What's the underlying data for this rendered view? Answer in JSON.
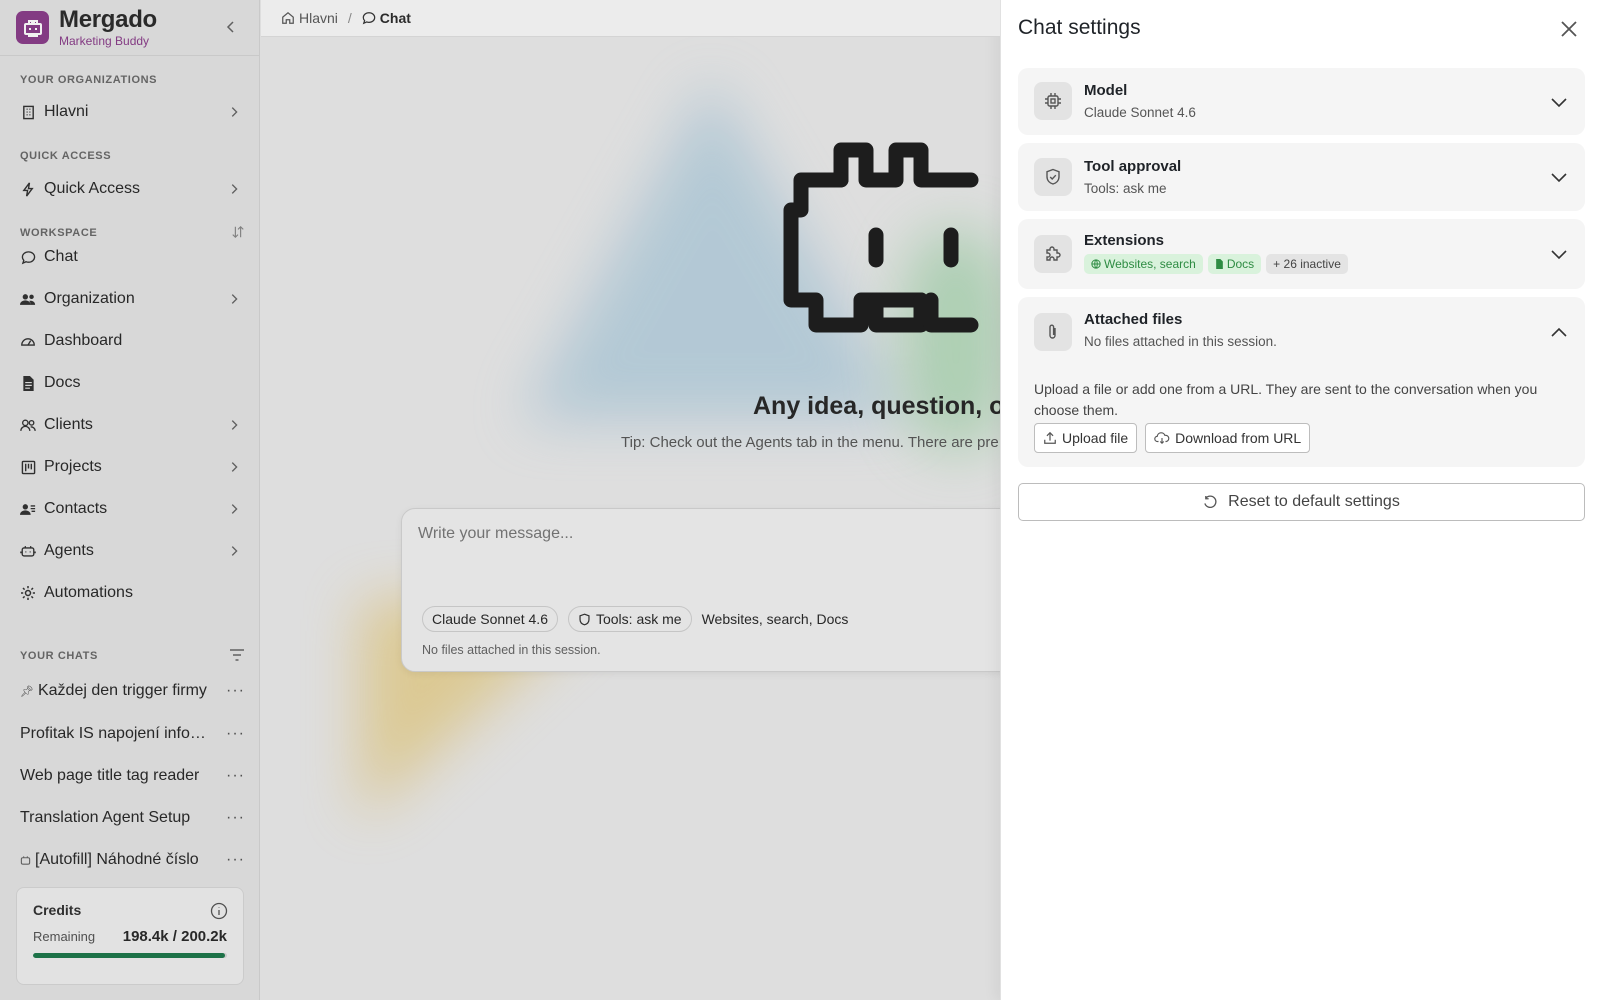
{
  "brand": {
    "name": "Mergado",
    "subtitle": "Marketing Buddy"
  },
  "sidebar": {
    "organizations_label": "YOUR ORGANIZATIONS",
    "organization": "Hlavni",
    "quick_access_label": "QUICK ACCESS",
    "quick_access": "Quick Access",
    "workspace_label": "WORKSPACE",
    "workspace_items": [
      {
        "label": "Chat",
        "icon": "chat-bubble-icon",
        "has_submenu": false
      },
      {
        "label": "Organization",
        "icon": "users-icon",
        "has_submenu": true
      },
      {
        "label": "Dashboard",
        "icon": "gauge-icon",
        "has_submenu": false
      },
      {
        "label": "Docs",
        "icon": "document-icon",
        "has_submenu": false
      },
      {
        "label": "Clients",
        "icon": "clients-icon",
        "has_submenu": true
      },
      {
        "label": "Projects",
        "icon": "kanban-icon",
        "has_submenu": true
      },
      {
        "label": "Contacts",
        "icon": "contacts-icon",
        "has_submenu": true
      },
      {
        "label": "Agents",
        "icon": "robot-icon",
        "has_submenu": true
      },
      {
        "label": "Automations",
        "icon": "gear-icon",
        "has_submenu": false
      }
    ],
    "chats_label": "YOUR CHATS",
    "chats": [
      {
        "label": "Každej den trigger firmy",
        "prefix": "pin"
      },
      {
        "label": "Profitak IS napojení informací",
        "prefix": ""
      },
      {
        "label": "Web page title tag reader",
        "prefix": ""
      },
      {
        "label": "Translation Agent Setup",
        "prefix": ""
      },
      {
        "label": "[Autofill] Náhodné číslo",
        "prefix": "bot"
      }
    ],
    "more_glyph": "···"
  },
  "credits": {
    "title": "Credits",
    "remaining_label": "Remaining",
    "remaining_value": "198.4k / 200.2k",
    "progress_fraction": 0.991
  },
  "breadcrumb": {
    "home": "Hlavni",
    "separator": "/",
    "current": "Chat"
  },
  "hero": {
    "title": "Any idea, question, or",
    "tip": "Tip: Check out the Agents tab in the menu. There are pre"
  },
  "composer": {
    "placeholder": "Write your message...",
    "model_chip": "Claude Sonnet 4.6",
    "tools_chip": "Tools: ask me",
    "extensions_text": "Websites, search, Docs",
    "files_text": "No files attached in this session."
  },
  "settings_panel": {
    "title": "Chat settings",
    "model": {
      "title": "Model",
      "value": "Claude Sonnet 4.6"
    },
    "tool_approval": {
      "title": "Tool approval",
      "value": "Tools: ask me"
    },
    "extensions": {
      "title": "Extensions",
      "tags": {
        "websites": "Websites, search",
        "docs": "Docs",
        "inactive": "+ 26 inactive"
      }
    },
    "attached_files": {
      "title": "Attached files",
      "value": "No files attached in this session.",
      "description": "Upload a file or add one from a URL. They are sent to the conversation when you choose them.",
      "upload_label": "Upload file",
      "download_label": "Download from URL"
    },
    "reset_label": "Reset to default settings"
  },
  "colors": {
    "brand": "#8c3f8c",
    "progress": "#1f7a4d",
    "tag_green": "#2e8c43"
  }
}
